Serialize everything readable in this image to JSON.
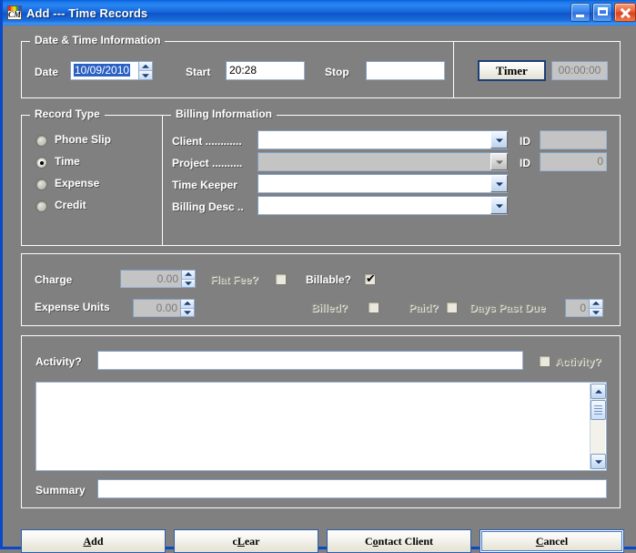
{
  "window": {
    "title": "Add --- Time Records",
    "icon": "cms-app-icon",
    "icon_text": "CMs",
    "buttons": {
      "minimize": "minimize-icon",
      "maximize": "maximize-icon",
      "close": "close-icon"
    },
    "accent": "#1565d8",
    "face": "#808080"
  },
  "datetime": {
    "group_label": "Date & Time Information",
    "date_label": "Date",
    "date_value": "10/09/2010",
    "start_label": "Start",
    "start_value": "20:28",
    "stop_label": "Stop",
    "stop_value": "",
    "timer_button": "Timer",
    "timer_accel": "T",
    "timer_display": "00:00:00"
  },
  "record_type": {
    "group_label": "Record Type",
    "options": [
      {
        "label": "Phone Slip",
        "selected": false
      },
      {
        "label": "Time",
        "selected": true
      },
      {
        "label": "Expense",
        "selected": false
      },
      {
        "label": "Credit",
        "selected": false
      }
    ]
  },
  "billing": {
    "group_label": "Billing Information",
    "rows": [
      {
        "label": "Client ............",
        "value": "",
        "id_label": "ID",
        "id_value": "",
        "disabled": false
      },
      {
        "label": "Project ..........",
        "value": "",
        "id_label": "ID",
        "id_value": "0",
        "disabled": true
      },
      {
        "label": "Time Keeper",
        "value": "",
        "disabled": false
      },
      {
        "label": "Billing Desc ..",
        "value": "",
        "disabled": false
      }
    ]
  },
  "charges": {
    "charge_label": "Charge",
    "charge_value": "0.00",
    "expense_units_label": "Expense Units",
    "expense_units_value": "0.00",
    "flat_fee_label": "Flat Fee?",
    "flat_fee_checked": false,
    "billable_label": "Billable?",
    "billable_checked": true,
    "billed_label": "Billed?",
    "billed_checked": false,
    "paid_label": "Paid?",
    "paid_checked": false,
    "days_past_due_label": "Days Past Due",
    "days_past_due_value": "0"
  },
  "activity": {
    "label": "Activity?",
    "value": "",
    "checkbox_label": "Activity?",
    "checkbox_checked": false,
    "notes_value": "",
    "summary_label": "Summary",
    "summary_value": ""
  },
  "footer": {
    "buttons": [
      {
        "label_pre": "",
        "label_accel": "A",
        "label_post": "dd",
        "name": "add-button",
        "focused": false
      },
      {
        "label_pre": "c",
        "label_accel": "L",
        "label_post": "ear",
        "name": "clear-button",
        "focused": false
      },
      {
        "label_pre": "C",
        "label_accel": "o",
        "label_post": "ntact Client",
        "name": "contact-client-button",
        "focused": false
      },
      {
        "label_pre": "",
        "label_accel": "C",
        "label_post": "ancel",
        "name": "cancel-button",
        "focused": true
      }
    ]
  }
}
